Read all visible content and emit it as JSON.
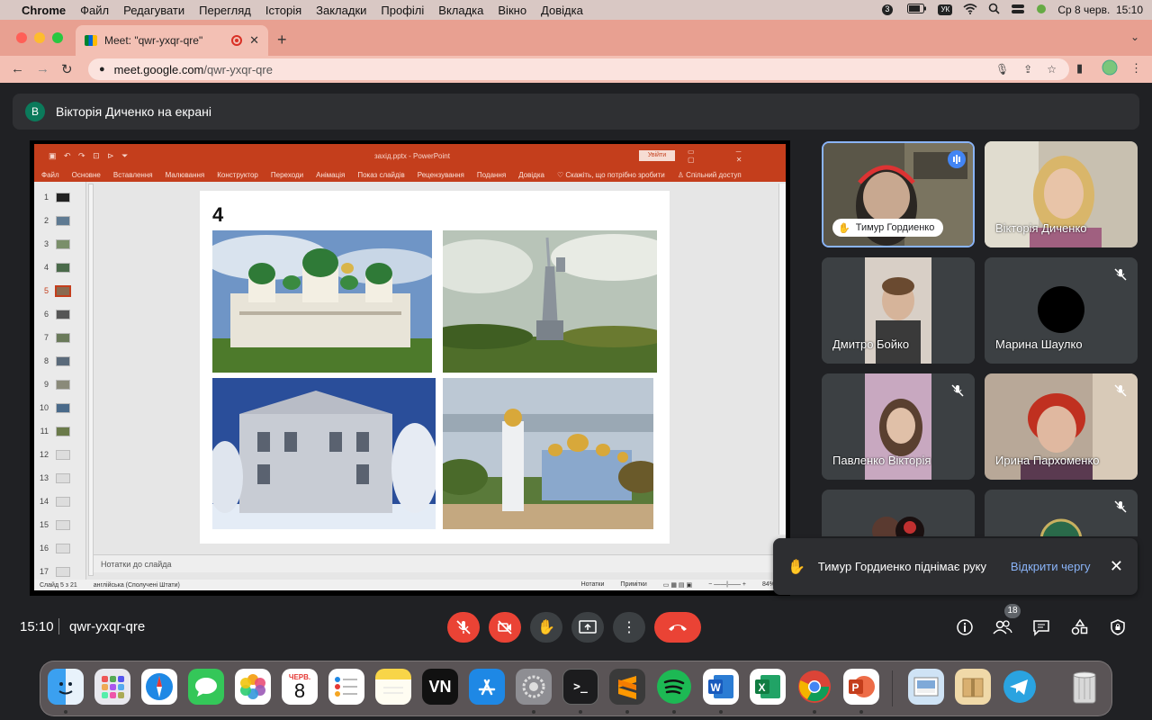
{
  "menubar": {
    "app": "Chrome",
    "items": [
      "Файл",
      "Редагувати",
      "Перегляд",
      "Історія",
      "Закладки",
      "Профілі",
      "Вкладка",
      "Вікно",
      "Довідка"
    ],
    "badge": "3",
    "lang": "УК",
    "clock": "Ср 8 черв.  15:10"
  },
  "browser": {
    "tab_title": "Meet: \"qwr-yxqr-qre\"",
    "url_host": "meet.google.com",
    "url_path": "/qwr-yxqr-qre"
  },
  "meet": {
    "presenter_initial": "В",
    "presenter_text": "Вікторія Диченко на екрані",
    "time": "15:10",
    "meeting_code": "qwr-yxqr-qre",
    "participants_count": "18",
    "toast_message": "Тимур Гордиенко піднімає руку",
    "toast_link": "Відкрити чергу"
  },
  "ppt": {
    "filename": "захід.pptx  -  PowerPoint",
    "login": "Увійти",
    "ribbon": [
      "Файл",
      "Основне",
      "Вставлення",
      "Малювання",
      "Конструктор",
      "Переходи",
      "Анімація",
      "Показ слайдів",
      "Рецензування",
      "Подання",
      "Довідка",
      "♡ Скажіть, що потрібно зробити",
      "♙ Спільний доступ"
    ],
    "slide_number_label": "4",
    "thumbnail_numbers": [
      "1",
      "2",
      "3",
      "4",
      "5",
      "6",
      "7",
      "8",
      "9",
      "10",
      "11",
      "12",
      "13",
      "14",
      "15",
      "16",
      "17"
    ],
    "selected_thumb": 5,
    "notes": "Нотатки до слайда",
    "status_left": "Слайд 5 з 21",
    "status_lang": "англійська (Сполучені Штати)",
    "status_notes": "Нотатки",
    "status_comments": "Примітки",
    "zoom": "84%"
  },
  "tiles": [
    {
      "name": "Тимур Гордиенко",
      "speaking": true
    },
    {
      "name": "Вікторія Диченко"
    },
    {
      "name": "Дмитро Бойко"
    },
    {
      "name": "Марина Шаулко",
      "muted": true
    },
    {
      "name": "Павленко Вікторія",
      "muted": true
    },
    {
      "name": "Ирина Пархоменко",
      "muted": true
    }
  ],
  "dock": {
    "calendar_month": "ЧЕРВ.",
    "calendar_day": "8",
    "vn_label": "VN"
  }
}
